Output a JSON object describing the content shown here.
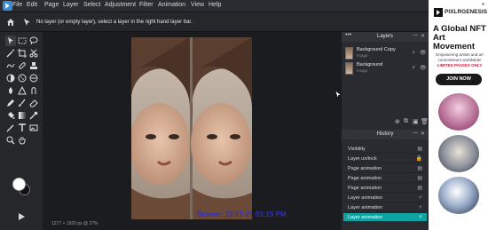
{
  "menu": [
    "File",
    "Edit",
    "Page",
    "Layer",
    "Select",
    "Adjustment",
    "Filter",
    "Animation",
    "View",
    "Help"
  ],
  "optionbar": {
    "hint": "No layer (or empty layer), select a layer in the right hand layer bar."
  },
  "layers_panel": {
    "title": "Layers",
    "items": [
      {
        "name": "Background Copy",
        "type": "Image"
      },
      {
        "name": "Background",
        "type": "Image"
      }
    ]
  },
  "history_panel": {
    "title": "History",
    "items": [
      "Visibility",
      "Layer un/lock",
      "Page animation",
      "Page animation",
      "Page animation",
      "Layer animation",
      "Layer animation",
      "Layer animation"
    ],
    "active_index": 7
  },
  "status": {
    "text": "1277 × 1920 px @ 27%"
  },
  "watermark": "Screen: 12-17-21 03:15 PM",
  "ad": {
    "brand": "PIXLRGENESIS",
    "headline": "A Global NFT Art Movement",
    "subtext": "Empowering artists and art connoisseurs worldwide!",
    "limited": "LIMITED PASSES ONLY",
    "button": "JOIN NOW"
  },
  "colors": {
    "accent": "#0fa3a3",
    "foreground": "#ffffff",
    "background": "#111111",
    "limited": "#d0183d"
  }
}
